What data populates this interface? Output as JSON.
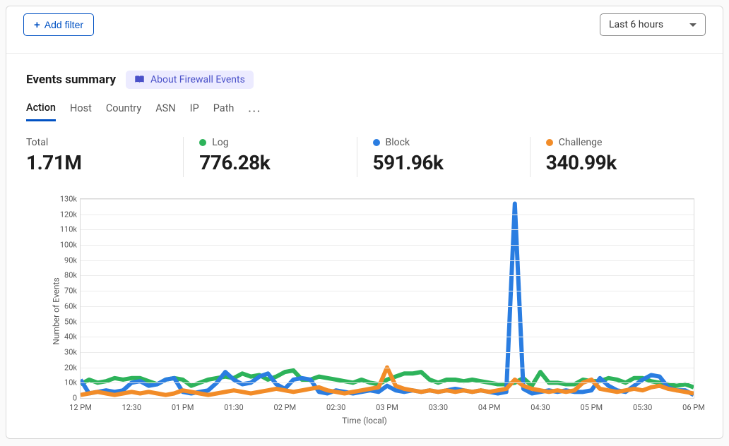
{
  "toolbar": {
    "add_filter_label": "Add filter",
    "time_range_selected": "Last 6 hours"
  },
  "summary": {
    "title": "Events summary",
    "about_label": "About Firewall Events"
  },
  "tabs": [
    "Action",
    "Host",
    "Country",
    "ASN",
    "IP",
    "Path"
  ],
  "active_tab_index": 0,
  "metrics": [
    {
      "label": "Total",
      "value": "1.71M",
      "color": null
    },
    {
      "label": "Log",
      "value": "776.28k",
      "color": "#2db35a"
    },
    {
      "label": "Block",
      "value": "591.96k",
      "color": "#2a7de1"
    },
    {
      "label": "Challenge",
      "value": "340.99k",
      "color": "#f28c28"
    }
  ],
  "chart_data": {
    "type": "line",
    "xlabel": "Time (local)",
    "ylabel": "Number of Events",
    "ylim": [
      0,
      130000
    ],
    "yticks": [
      0,
      10000,
      20000,
      30000,
      40000,
      50000,
      60000,
      70000,
      80000,
      90000,
      100000,
      110000,
      120000,
      130000
    ],
    "ytick_labels": [
      "0",
      "10k",
      "20k",
      "30k",
      "40k",
      "50k",
      "60k",
      "70k",
      "80k",
      "90k",
      "100k",
      "110k",
      "120k",
      "130k"
    ],
    "categories": [
      "12 PM",
      "12:30",
      "01 PM",
      "01:30",
      "02 PM",
      "02:30",
      "03 PM",
      "03:30",
      "04 PM",
      "04:30",
      "05 PM",
      "05:30",
      "06 PM"
    ],
    "n_points": 73,
    "series": [
      {
        "name": "Log",
        "color": "#2db35a",
        "values": [
          9000,
          12000,
          10000,
          11000,
          13000,
          12000,
          13000,
          13000,
          11000,
          9000,
          12000,
          13000,
          12000,
          8000,
          10000,
          12000,
          13000,
          14000,
          13000,
          16000,
          14000,
          15000,
          12000,
          14000,
          17000,
          18000,
          12000,
          12000,
          14000,
          13000,
          12000,
          11000,
          10000,
          12000,
          10000,
          9000,
          12000,
          14000,
          16000,
          16000,
          17000,
          12000,
          10000,
          12000,
          12000,
          11000,
          12000,
          11000,
          10000,
          9000,
          9000,
          10000,
          13000,
          8000,
          17000,
          10000,
          10000,
          9000,
          9000,
          12000,
          11000,
          11000,
          13000,
          12000,
          10000,
          13000,
          13000,
          11000,
          10000,
          9000,
          8000,
          9000,
          7000
        ]
      },
      {
        "name": "Block",
        "color": "#2a7de1",
        "values": [
          12000,
          3000,
          4000,
          5000,
          4000,
          5000,
          10000,
          11000,
          8000,
          9000,
          12000,
          13000,
          4000,
          3000,
          4000,
          5000,
          10000,
          17000,
          12000,
          9000,
          10000,
          14000,
          16000,
          9000,
          6000,
          12000,
          13000,
          12000,
          4000,
          3000,
          5000,
          4000,
          3000,
          4000,
          5000,
          4000,
          8000,
          5000,
          4000,
          5000,
          4000,
          5000,
          4000,
          5000,
          6000,
          5000,
          4000,
          5000,
          4000,
          3000,
          4000,
          127000,
          6000,
          3000,
          4000,
          5000,
          4000,
          5000,
          4000,
          4000,
          5000,
          13000,
          8000,
          5000,
          4000,
          8000,
          12000,
          15000,
          14000,
          7000,
          5000,
          5000,
          2000
        ]
      },
      {
        "name": "Challenge",
        "color": "#f28c28",
        "values": [
          2000,
          3000,
          4000,
          3000,
          2000,
          3000,
          4000,
          3000,
          4000,
          3000,
          2000,
          3000,
          5000,
          4000,
          3000,
          2000,
          3000,
          4000,
          5000,
          4000,
          3000,
          4000,
          5000,
          6000,
          5000,
          4000,
          5000,
          6000,
          7000,
          5000,
          4000,
          3000,
          4000,
          5000,
          6000,
          7000,
          20000,
          8000,
          6000,
          5000,
          4000,
          5000,
          4000,
          5000,
          4000,
          5000,
          4000,
          5000,
          4000,
          5000,
          6000,
          12000,
          8000,
          6000,
          5000,
          4000,
          5000,
          4000,
          5000,
          10000,
          12000,
          6000,
          5000,
          4000,
          5000,
          6000,
          5000,
          7000,
          8000,
          6000,
          5000,
          4000,
          3000
        ]
      }
    ]
  }
}
